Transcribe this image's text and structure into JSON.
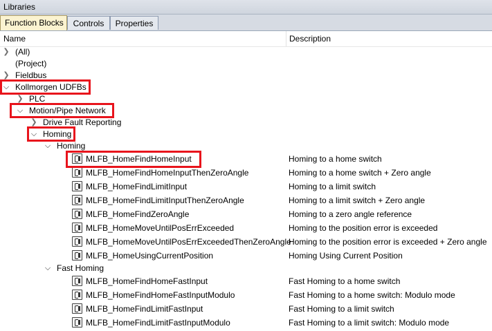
{
  "window": {
    "title": "Libraries"
  },
  "tabs": [
    {
      "label": "Function Blocks",
      "active": true
    },
    {
      "label": "Controls",
      "active": false
    },
    {
      "label": "Properties",
      "active": false
    }
  ],
  "columns": {
    "name": "Name",
    "description": "Description"
  },
  "tree": {
    "all": "(All)",
    "project": "(Project)",
    "fieldbus": "Fieldbus",
    "kollmorgen": "Kollmorgen UDFBs",
    "plc": "PLC",
    "motion": "Motion/Pipe Network",
    "drive_fault": "Drive Fault Reporting",
    "homing_top": "Homing",
    "homing_sub": "Homing",
    "fast_homing": "Fast Homing",
    "homing_blocks": [
      {
        "name": "MLFB_HomeFindHomeInput",
        "desc": "Homing to a home switch"
      },
      {
        "name": "MLFB_HomeFindHomeInputThenZeroAngle",
        "desc": "Homing to a home switch + Zero angle"
      },
      {
        "name": "MLFB_HomeFindLimitInput",
        "desc": "Homing to a limit switch"
      },
      {
        "name": "MLFB_HomeFindLimitInputThenZeroAngle",
        "desc": "Homing to a limit switch + Zero angle"
      },
      {
        "name": "MLFB_HomeFindZeroAngle",
        "desc": "Homing to a zero angle reference"
      },
      {
        "name": "MLFB_HomeMoveUntilPosErrExceeded",
        "desc": "Homing to the position error is exceeded"
      },
      {
        "name": "MLFB_HomeMoveUntilPosErrExceededThenZeroAngle",
        "desc": "Homing to the position error is exceeded + Zero angle"
      },
      {
        "name": "MLFB_HomeUsingCurrentPosition",
        "desc": "Homing Using Current Position"
      }
    ],
    "fast_blocks": [
      {
        "name": "MLFB_HomeFindHomeFastInput",
        "desc": "Fast Homing to a home switch"
      },
      {
        "name": "MLFB_HomeFindHomeFastInputModulo",
        "desc": "Fast Homing to a home switch: Modulo mode"
      },
      {
        "name": "MLFB_HomeFindLimitFastInput",
        "desc": "Fast Homing to a limit switch"
      },
      {
        "name": "MLFB_HomeFindLimitFastInputModulo",
        "desc": "Fast Homing to a limit switch: Modulo mode"
      }
    ]
  },
  "colors": {
    "highlight": "#e8141c",
    "active_tab": "#fbf3d0"
  },
  "icons": {
    "collapsed": "chevron-right-icon",
    "expanded": "chevron-down-icon",
    "block": "function-block-icon"
  }
}
